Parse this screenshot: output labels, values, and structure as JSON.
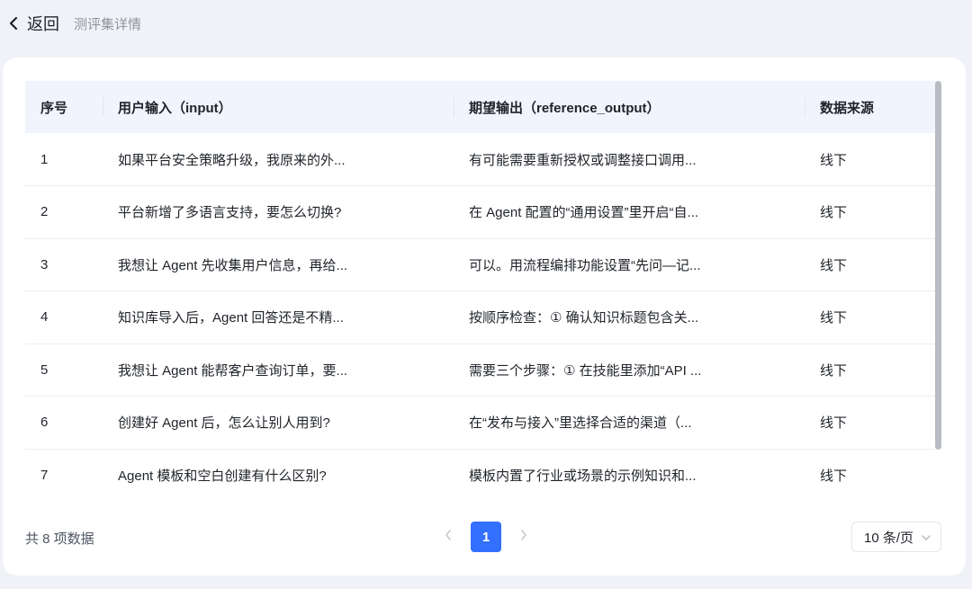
{
  "header": {
    "back_label": "返回",
    "page_title": "测评集详情"
  },
  "table": {
    "columns": [
      "序号",
      "用户输入（input）",
      "期望输出（reference_output）",
      "数据来源"
    ],
    "rows": [
      [
        "1",
        "如果平台安全策略升级，我原来的外...",
        "有可能需要重新授权或调整接口调用...",
        "线下"
      ],
      [
        "2",
        "平台新增了多语言支持，要怎么切换?",
        "在 Agent 配置的“通用设置”里开启“自...",
        "线下"
      ],
      [
        "3",
        "我想让 Agent 先收集用户信息，再给...",
        "可以。用流程编排功能设置“先问—记...",
        "线下"
      ],
      [
        "4",
        "知识库导入后，Agent 回答还是不精...",
        "按顺序检查：① 确认知识标题包含关...",
        "线下"
      ],
      [
        "5",
        "我想让 Agent 能帮客户查询订单，要...",
        "需要三个步骤：① 在技能里添加“API ...",
        "线下"
      ],
      [
        "6",
        "创建好 Agent 后，怎么让别人用到?",
        "在“发布与接入”里选择合适的渠道（...",
        "线下"
      ],
      [
        "7",
        "Agent 模板和空白创建有什么区别?",
        "模板内置了行业或场景的示例知识和...",
        "线下"
      ]
    ]
  },
  "footer": {
    "total_label": "共 8 项数据",
    "current_page": "1",
    "page_size_label": "10 条/页"
  },
  "icons": {
    "back": "chevron-left-icon",
    "prev": "chevron-left-icon",
    "next": "chevron-right-icon",
    "dropdown": "chevron-down-icon"
  },
  "colors": {
    "accent": "#3370ff",
    "header_bg": "#f1f4fd",
    "page_bg": "#f0f2f7"
  }
}
